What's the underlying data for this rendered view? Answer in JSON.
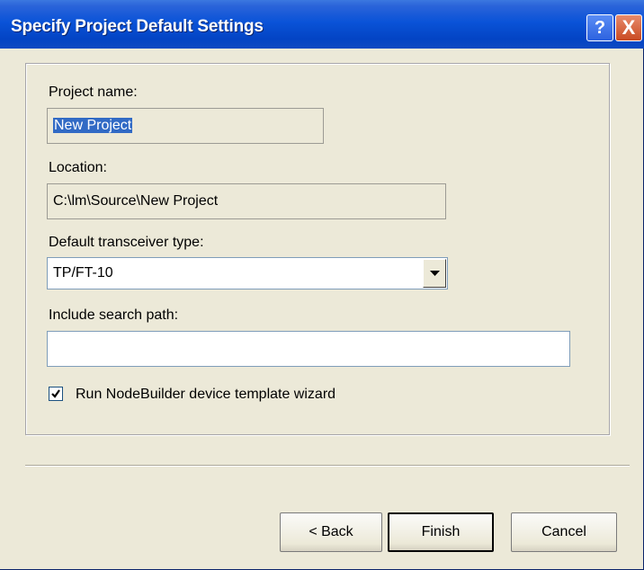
{
  "window": {
    "title": "Specify Project Default Settings",
    "help_glyph": "?",
    "close_glyph": "X"
  },
  "form": {
    "project_name_label": "Project name:",
    "project_name_value": "New Project",
    "location_label": "Location:",
    "location_value": "C:\\lm\\Source\\New Project",
    "transceiver_label": "Default transceiver type:",
    "transceiver_value": "TP/FT-10",
    "search_path_label": "Include search path:",
    "search_path_value": "",
    "wizard_checkbox_label": "Run NodeBuilder device template wizard",
    "wizard_checked": true
  },
  "buttons": {
    "back": "< Back",
    "finish": "Finish",
    "cancel": "Cancel"
  },
  "colors": {
    "titlebar": "#0a53d8",
    "dialog_bg": "#ece9d8",
    "selection": "#316ac5"
  }
}
